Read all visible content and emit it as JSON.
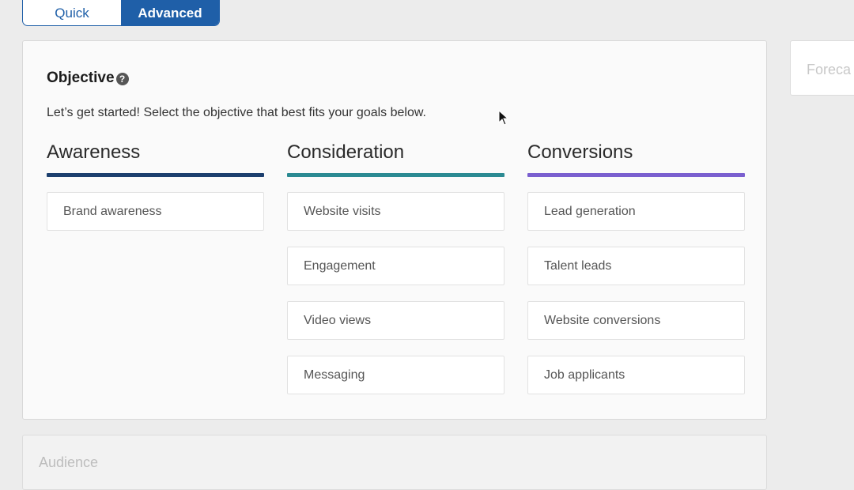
{
  "mode_toggle": {
    "quick": "Quick",
    "advanced": "Advanced",
    "selected": "Advanced"
  },
  "objective": {
    "title": "Objective",
    "help_glyph": "?",
    "subtitle": "Let’s get started! Select the objective that best fits your goals below.",
    "columns": [
      {
        "title": "Awareness",
        "color": "#1c3f6e",
        "options": [
          "Brand awareness"
        ]
      },
      {
        "title": "Consideration",
        "color": "#2b8a92",
        "options": [
          "Website visits",
          "Engagement",
          "Video views",
          "Messaging"
        ]
      },
      {
        "title": "Conversions",
        "color": "#7a5fcf",
        "options": [
          "Lead generation",
          "Talent leads",
          "Website conversions",
          "Job applicants"
        ]
      }
    ]
  },
  "forecast": {
    "label": "Foreca"
  },
  "audience": {
    "title": "Audience"
  },
  "colors": {
    "primary": "#1f5fa8"
  }
}
